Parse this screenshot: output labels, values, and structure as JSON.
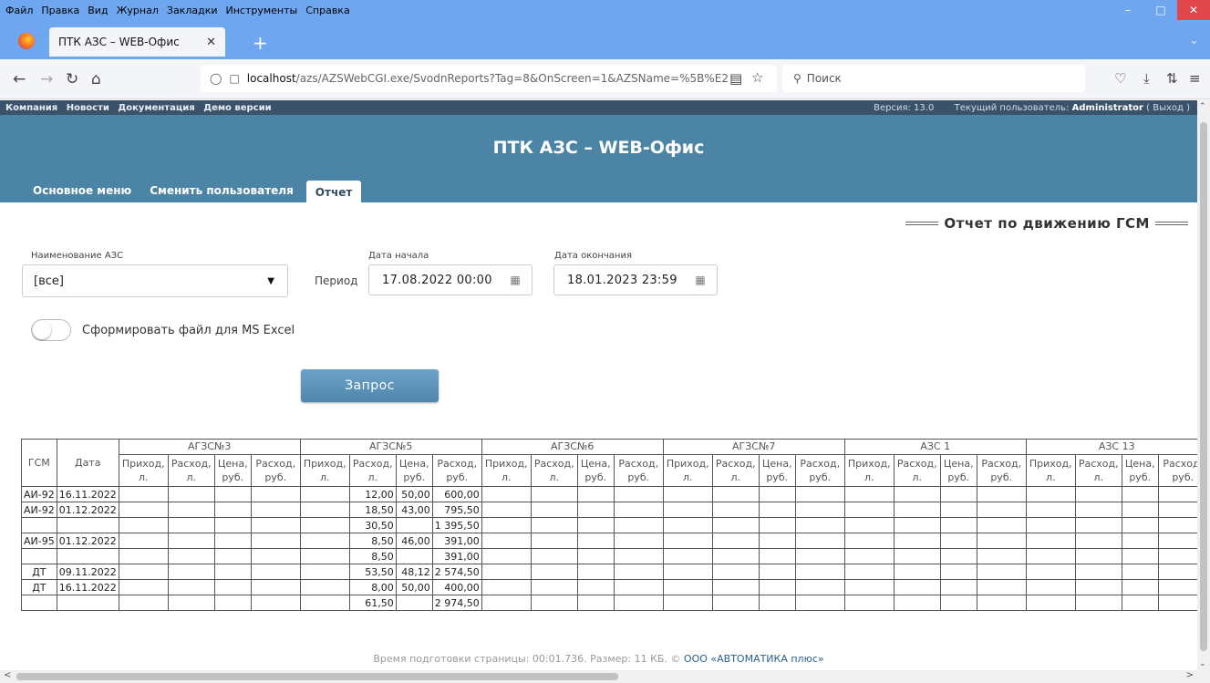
{
  "browser": {
    "menu": [
      "Файл",
      "Правка",
      "Вид",
      "Журнал",
      "Закладки",
      "Инструменты",
      "Справка"
    ],
    "tab_title": "ПТК АЗС – WEB-Офис",
    "url_host": "localhost",
    "url_rest": "/azs/AZSWebCGI.exe/SvodnReports?Tag=8&OnScreen=1&AZSName=%5B%E2",
    "search_placeholder": "Поиск"
  },
  "topstrip": {
    "links": [
      "Компания",
      "Новости",
      "Документация",
      "Демо версии"
    ],
    "version": "Версия: 13.0",
    "user_label": "Текущий пользователь:",
    "user_name": "Administrator",
    "logout": "( Выход )"
  },
  "header": {
    "title": "ПТК АЗС – WEB-Офис",
    "tabs": [
      "Основное меню",
      "Сменить пользователя",
      "Отчет"
    ]
  },
  "report": {
    "title": "Отчет по движению ГСМ",
    "azs_label": "Наименование АЗС",
    "azs_value": "[все]",
    "period_label": "Период",
    "start_label": "Дата начала",
    "start_value": "17.08.2022  00:00",
    "end_label": "Дата окончания",
    "end_value": "18.01.2023  23:59",
    "excel_label": "Сформировать файл для MS Excel",
    "excel_enabled": false,
    "query_button": "Запрос"
  },
  "table": {
    "col_gsm": "ГСМ",
    "col_date": "Дата",
    "stations": [
      "АГЗС№3",
      "АГЗС№5",
      "АГЗС№6",
      "АГЗС№7",
      "АЗС 1",
      "АЗС 13"
    ],
    "sub_cols": [
      "Приход, л.",
      "Расход, л.",
      "Цена, руб.",
      "Расход, руб."
    ],
    "rows": [
      {
        "gsm": "АИ-92",
        "date": "16.11.2022",
        "v": [
          "12,00",
          "50,00",
          "600,00"
        ]
      },
      {
        "gsm": "АИ-92",
        "date": "01.12.2022",
        "v": [
          "18,50",
          "43,00",
          "795,50"
        ]
      },
      {
        "gsm": "",
        "date": "",
        "v": [
          "30,50",
          "",
          "1 395,50"
        ]
      },
      {
        "gsm": "АИ-95",
        "date": "01.12.2022",
        "v": [
          "8,50",
          "46,00",
          "391,00"
        ]
      },
      {
        "gsm": "",
        "date": "",
        "v": [
          "8,50",
          "",
          "391,00"
        ]
      },
      {
        "gsm": "ДТ",
        "date": "09.11.2022",
        "v": [
          "53,50",
          "48,12",
          "2 574,50"
        ]
      },
      {
        "gsm": "ДТ",
        "date": "16.11.2022",
        "v": [
          "8,00",
          "50,00",
          "400,00"
        ]
      },
      {
        "gsm": "",
        "date": "",
        "v": [
          "61,50",
          "",
          "2 974,50"
        ]
      }
    ]
  },
  "footer": {
    "text": "Время подготовки страницы: 00:01.736. Размер: 11 КБ. ©",
    "org": "ООО «АВТОМАТИКА плюс»"
  },
  "colors": {
    "header_bg": "#4c84a6",
    "topstrip_bg": "#3b536a",
    "browser_bg": "#6ea6ef",
    "button_bg": "#5a91b8"
  }
}
